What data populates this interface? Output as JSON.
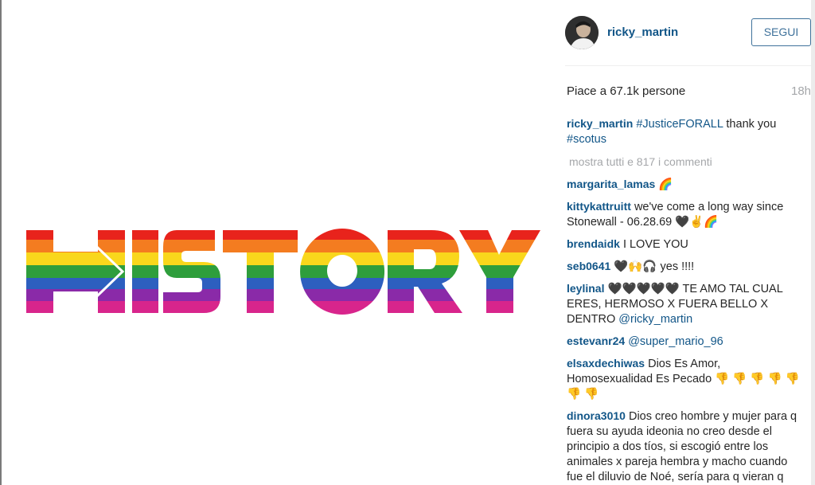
{
  "post": {
    "image_word": "HISTORY",
    "rainbow_colors": [
      "#e8231c",
      "#f47c20",
      "#f9d71c",
      "#2e9e3c",
      "#2d5fbf",
      "#8a2aa8",
      "#d8258c"
    ]
  },
  "author": {
    "username": "ricky_martin",
    "avatar_icon": "profile-photo"
  },
  "follow_button_label": "SEGUI",
  "likes_text": "Piace a 67.1k persone",
  "timestamp": "18h",
  "caption": {
    "user": "ricky_martin",
    "hashtag1": "#JusticeFORALL",
    "text": "thank you",
    "hashtag2": "#scotus"
  },
  "show_all_comments": "mostra tutti e 817 i commenti",
  "comments": [
    {
      "user": "margarita_lamas",
      "text": "🌈"
    },
    {
      "user": "kittykattruitt",
      "text": "we've come a long way since Stonewall - 06.28.69 🖤✌🌈"
    },
    {
      "user": "brendaidk",
      "text": "I LOVE YOU"
    },
    {
      "user": "seb0641",
      "text": "🖤🙌🎧 yes !!!!"
    },
    {
      "user": "leylinal",
      "text": "🖤🖤🖤🖤🖤 TE AMO TAL CUAL ERES, HERMOSO X FUERA BELLO X DENTRO",
      "mention": "@ricky_martin"
    },
    {
      "user": "estevanr24",
      "text": "",
      "mention": "@super_mario_96"
    },
    {
      "user": "elsaxdechiwas",
      "text": "Dios Es Amor, Homosexualidad Es Pecado 👎 👎 👎 👎 👎 👎 👎"
    },
    {
      "user": "dinora3010",
      "text": "Dios creo hombre y mujer para q fuera su ayuda ideonia no creo desde el principio a dos tíos, si escogió entre los animales x pareja hembra y macho cuando fue el diluvio de Noé, sería para q vieran q solo entre hembra y"
    }
  ]
}
